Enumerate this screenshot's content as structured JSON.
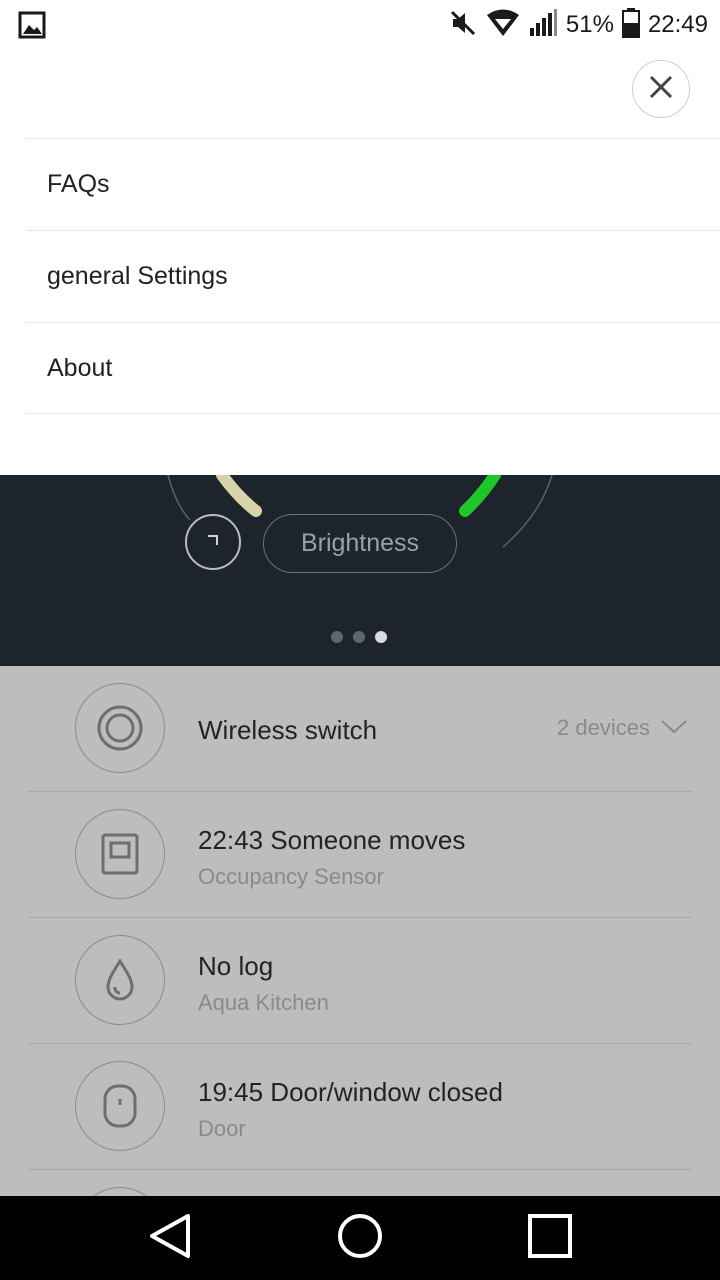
{
  "status_bar": {
    "battery": "51%",
    "time": "22:49",
    "icons": [
      "gallery-icon",
      "mute-icon",
      "wifi-icon",
      "signal-icon",
      "battery-icon"
    ]
  },
  "menu": {
    "close_icon": "close-icon",
    "items": [
      {
        "label": "FAQs"
      },
      {
        "label": "general Settings"
      },
      {
        "label": "About"
      }
    ]
  },
  "control": {
    "brightness_label": "Brightness",
    "page_indicator": {
      "count": 3,
      "active": 3
    }
  },
  "devices": [
    {
      "title": "Wireless switch",
      "subtitle": "",
      "right": "2 devices",
      "icon": "wireless-switch-icon"
    },
    {
      "title": "22:43  Someone moves",
      "subtitle": "Occupancy Sensor",
      "icon": "occupancy-sensor-icon"
    },
    {
      "title": "No log",
      "subtitle": "Aqua Kitchen",
      "icon": "water-drop-icon"
    },
    {
      "title": "19:45  Door/window closed",
      "subtitle": "Door",
      "icon": "door-sensor-icon"
    }
  ],
  "colors": {
    "dark_panel": "#1d242c",
    "gauge_green": "#1fc62a",
    "gauge_warm": "#d8d3a8",
    "overlay_list": "#bdbdbd"
  },
  "nav": {
    "icons": [
      "back-icon",
      "home-icon",
      "recents-icon"
    ]
  }
}
